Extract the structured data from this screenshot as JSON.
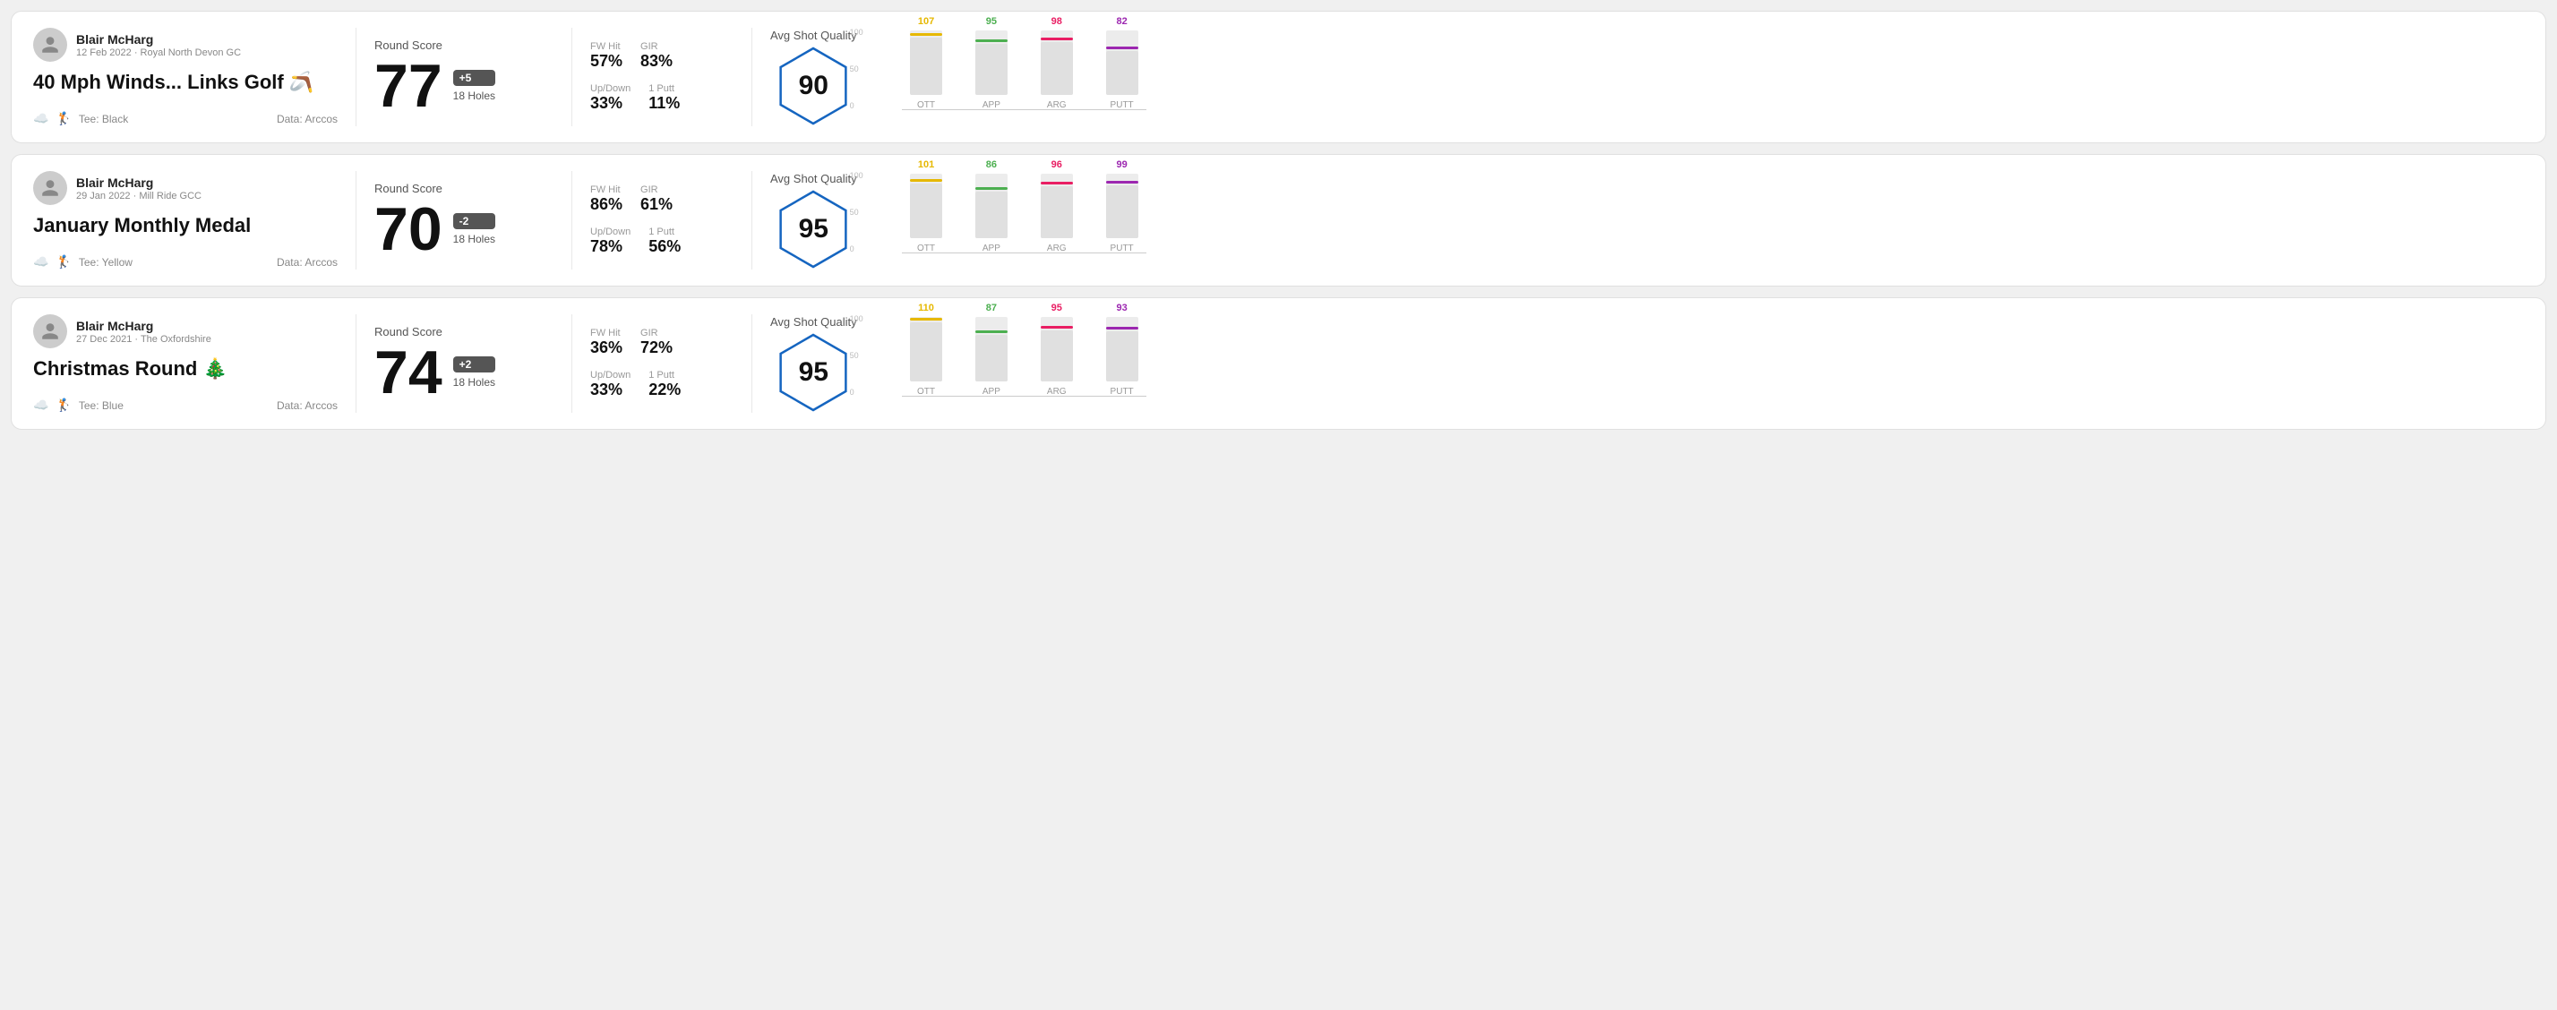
{
  "rounds": [
    {
      "id": "round-1",
      "player_name": "Blair McHarg",
      "player_meta": "12 Feb 2022 · Royal North Devon GC",
      "round_title": "40 Mph Winds... Links Golf 🪃",
      "tee": "Black",
      "data_source": "Data: Arccos",
      "round_score_label": "Round Score",
      "score": "77",
      "score_badge": "+5",
      "score_holes": "18 Holes",
      "fw_hit_label": "FW Hit",
      "fw_hit_value": "57%",
      "gir_label": "GIR",
      "gir_value": "83%",
      "updown_label": "Up/Down",
      "updown_value": "33%",
      "oneputt_label": "1 Putt",
      "oneputt_value": "11%",
      "quality_label": "Avg Shot Quality",
      "quality_score": "90",
      "bars": [
        {
          "label": "OTT",
          "value": 107,
          "color": "#e6b800",
          "pct": 72
        },
        {
          "label": "APP",
          "value": 95,
          "color": "#4caf50",
          "pct": 64
        },
        {
          "label": "ARG",
          "value": 98,
          "color": "#e91e63",
          "pct": 66
        },
        {
          "label": "PUTT",
          "value": 82,
          "color": "#9c27b0",
          "pct": 55
        }
      ]
    },
    {
      "id": "round-2",
      "player_name": "Blair McHarg",
      "player_meta": "29 Jan 2022 · Mill Ride GCC",
      "round_title": "January Monthly Medal",
      "tee": "Yellow",
      "data_source": "Data: Arccos",
      "round_score_label": "Round Score",
      "score": "70",
      "score_badge": "-2",
      "score_holes": "18 Holes",
      "fw_hit_label": "FW Hit",
      "fw_hit_value": "86%",
      "gir_label": "GIR",
      "gir_value": "61%",
      "updown_label": "Up/Down",
      "updown_value": "78%",
      "oneputt_label": "1 Putt",
      "oneputt_value": "56%",
      "quality_label": "Avg Shot Quality",
      "quality_score": "95",
      "bars": [
        {
          "label": "OTT",
          "value": 101,
          "color": "#e6b800",
          "pct": 68
        },
        {
          "label": "APP",
          "value": 86,
          "color": "#4caf50",
          "pct": 58
        },
        {
          "label": "ARG",
          "value": 96,
          "color": "#e91e63",
          "pct": 64
        },
        {
          "label": "PUTT",
          "value": 99,
          "color": "#9c27b0",
          "pct": 66
        }
      ]
    },
    {
      "id": "round-3",
      "player_name": "Blair McHarg",
      "player_meta": "27 Dec 2021 · The Oxfordshire",
      "round_title": "Christmas Round 🎄",
      "tee": "Blue",
      "data_source": "Data: Arccos",
      "round_score_label": "Round Score",
      "score": "74",
      "score_badge": "+2",
      "score_holes": "18 Holes",
      "fw_hit_label": "FW Hit",
      "fw_hit_value": "36%",
      "gir_label": "GIR",
      "gir_value": "72%",
      "updown_label": "Up/Down",
      "updown_value": "33%",
      "oneputt_label": "1 Putt",
      "oneputt_value": "22%",
      "quality_label": "Avg Shot Quality",
      "quality_score": "95",
      "bars": [
        {
          "label": "OTT",
          "value": 110,
          "color": "#e6b800",
          "pct": 73
        },
        {
          "label": "APP",
          "value": 87,
          "color": "#4caf50",
          "pct": 58
        },
        {
          "label": "ARG",
          "value": 95,
          "color": "#e91e63",
          "pct": 63
        },
        {
          "label": "PUTT",
          "value": 93,
          "color": "#9c27b0",
          "pct": 62
        }
      ]
    }
  ]
}
